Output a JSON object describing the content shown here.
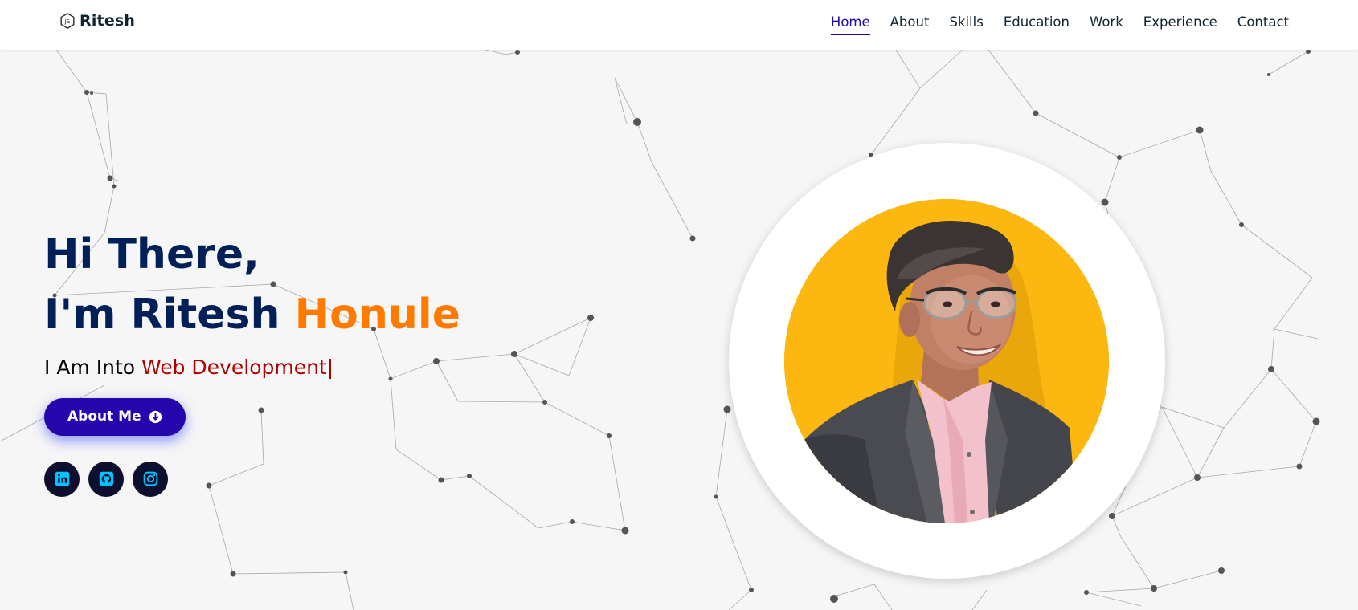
{
  "brand": {
    "name": "Ritesh",
    "icon": "nodejs-hexagon-icon"
  },
  "nav": {
    "items": [
      {
        "label": "Home",
        "active": true
      },
      {
        "label": "About",
        "active": false
      },
      {
        "label": "Skills",
        "active": false
      },
      {
        "label": "Education",
        "active": false
      },
      {
        "label": "Work",
        "active": false
      },
      {
        "label": "Experience",
        "active": false
      },
      {
        "label": "Contact",
        "active": false
      }
    ]
  },
  "hero": {
    "line1": "Hi There,",
    "line2_prefix": "I'm Ritesh ",
    "line2_highlight": "Honule",
    "tagline_prefix": "I Am Into ",
    "tagline_typed": "Web Development",
    "cursor": "|",
    "button_label": "About Me",
    "button_icon": "arrow-down-circle-icon"
  },
  "socials": [
    {
      "name": "linkedin",
      "icon": "linkedin-icon"
    },
    {
      "name": "github",
      "icon": "github-icon"
    },
    {
      "name": "instagram",
      "icon": "instagram-icon"
    }
  ],
  "profile_image": {
    "icon": "profile-photo"
  },
  "colors": {
    "primary": "#2506ad",
    "heading": "#002057",
    "highlight": "#ff7b00",
    "typed": "#b10000",
    "photo_bg": "#fcb711",
    "social_bg": "#0e0e2e",
    "social_icon": "#00c3ff"
  }
}
